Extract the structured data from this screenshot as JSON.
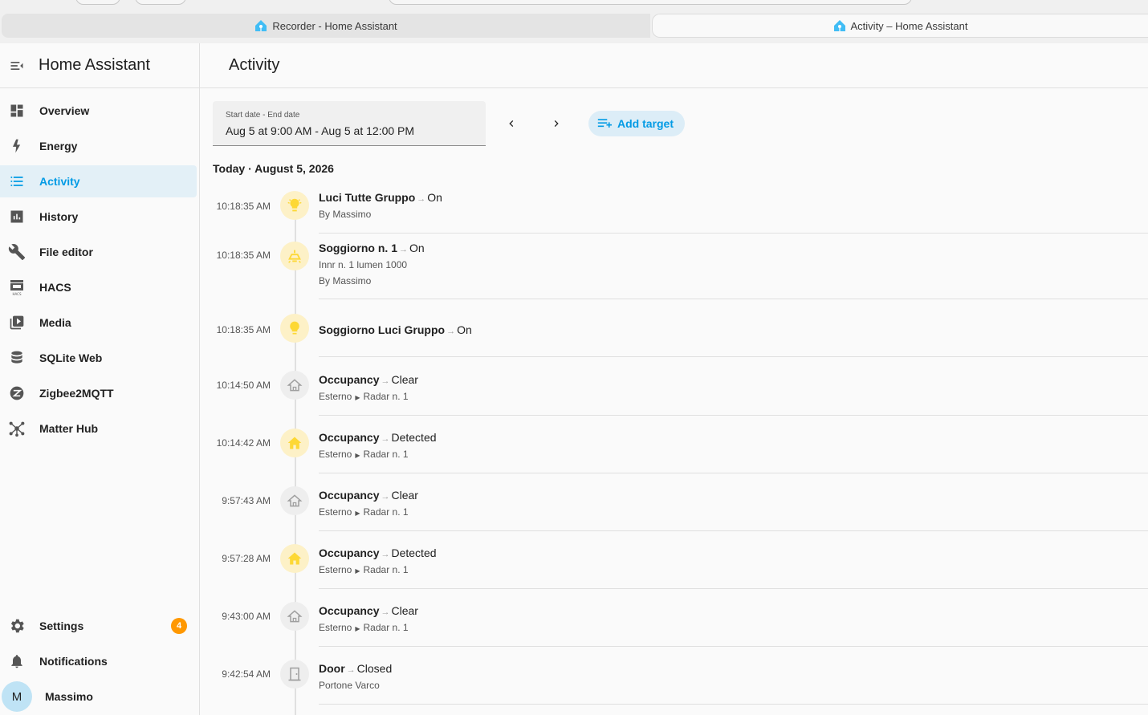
{
  "browser": {
    "tabs": [
      {
        "label": "Recorder - Home Assistant",
        "active": false
      },
      {
        "label": "Activity – Home Assistant",
        "active": true
      }
    ]
  },
  "sidebar": {
    "title": "Home Assistant",
    "items": [
      {
        "label": "Overview",
        "icon": "dashboard-icon"
      },
      {
        "label": "Energy",
        "icon": "lightning-icon"
      },
      {
        "label": "Activity",
        "icon": "list-icon",
        "selected": true
      },
      {
        "label": "History",
        "icon": "chart-icon"
      },
      {
        "label": "File editor",
        "icon": "wrench-icon"
      },
      {
        "label": "HACS",
        "icon": "store-icon"
      },
      {
        "label": "Media",
        "icon": "media-icon"
      },
      {
        "label": "SQLite Web",
        "icon": "database-icon"
      },
      {
        "label": "Zigbee2MQTT",
        "icon": "zigbee-icon"
      },
      {
        "label": "Matter Hub",
        "icon": "hub-icon"
      }
    ],
    "bottom": {
      "settings": {
        "label": "Settings",
        "badge": "4"
      },
      "notifications": {
        "label": "Notifications"
      },
      "user": {
        "label": "Massimo",
        "initial": "M"
      }
    }
  },
  "main": {
    "title": "Activity",
    "date_range": {
      "label": "Start date - End date",
      "value": "Aug 5 at 9:00 AM - Aug 5 at 12:00 PM"
    },
    "add_target_label": "Add target",
    "day_heading": "Today · August 5, 2026",
    "entries": [
      {
        "time": "10:18:35 AM",
        "name": "Luci Tutte Gruppo",
        "state": "On",
        "sub": "By Massimo",
        "sub2": "",
        "icon": "lightbulb-group-icon",
        "active": true
      },
      {
        "time": "10:18:35 AM",
        "name": "Soggiorno n. 1",
        "state": "On",
        "sub": "Innr n. 1 lumen 1000",
        "sub2": "By Massimo",
        "icon": "ceiling-light-icon",
        "active": true
      },
      {
        "time": "10:18:35 AM",
        "name": "Soggiorno Luci Gruppo",
        "state": "On",
        "sub": "",
        "sub2": "",
        "icon": "lightbulb-icon",
        "active": true
      },
      {
        "time": "10:14:50 AM",
        "name": "Occupancy",
        "state": "Clear",
        "area": "Esterno",
        "device": "Radar n. 1",
        "icon": "home-outline-icon",
        "active": false
      },
      {
        "time": "10:14:42 AM",
        "name": "Occupancy",
        "state": "Detected",
        "area": "Esterno",
        "device": "Radar n. 1",
        "icon": "home-icon",
        "active": true
      },
      {
        "time": "9:57:43 AM",
        "name": "Occupancy",
        "state": "Clear",
        "area": "Esterno",
        "device": "Radar n. 1",
        "icon": "home-outline-icon",
        "active": false
      },
      {
        "time": "9:57:28 AM",
        "name": "Occupancy",
        "state": "Detected",
        "area": "Esterno",
        "device": "Radar n. 1",
        "icon": "home-icon",
        "active": true
      },
      {
        "time": "9:43:00 AM",
        "name": "Occupancy",
        "state": "Clear",
        "area": "Esterno",
        "device": "Radar n. 1",
        "icon": "home-outline-icon",
        "active": false
      },
      {
        "time": "9:42:54 AM",
        "name": "Door",
        "state": "Closed",
        "sub": "Portone Varco",
        "icon": "door-icon",
        "active": false
      }
    ]
  },
  "colors": {
    "accent": "#039be5",
    "active_icon": "#fdd835",
    "badge": "#ff9800"
  }
}
